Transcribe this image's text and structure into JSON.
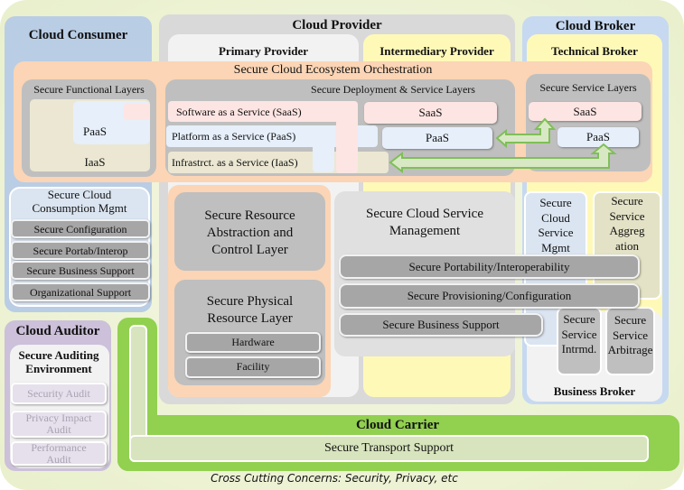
{
  "consumer": {
    "title": "Cloud Consumer",
    "consumption_mgmt": "Secure Cloud Consumption Mgmt",
    "items": [
      "Secure Configuration",
      "Secure Portab/Interop",
      "Secure Business Support",
      "Organizational Support"
    ]
  },
  "provider": {
    "title": "Cloud Provider",
    "primary": "Primary  Provider",
    "intermediary": "Intermediary Provider"
  },
  "broker": {
    "title": "Cloud Broker",
    "technical": "Technical Broker",
    "business": "Business Broker",
    "service_mgmt": "Secure Cloud Service Mgmt",
    "aggregation": "Secure Service Aggreg ation",
    "intermediation": "Secure Service Intrmd.",
    "arbitrage": "Secure Service Arbitrage"
  },
  "orchestration": {
    "title": "Secure Cloud Ecosystem Orchestration",
    "functional": {
      "title": "Secure Functional Layers",
      "paas": "PaaS",
      "iaas": "IaaS"
    },
    "deployment": {
      "title": "Secure Deployment & Service Layers",
      "saas_full": "Software as a Service (SaaS)",
      "paas_full": "Platform as a Service (PaaS)",
      "iaas_full": "Infrastrct. as a Service (IaaS)",
      "saas": "SaaS",
      "paas": "PaaS"
    },
    "service_layers": {
      "title": "Secure Service Layers",
      "saas": "SaaS",
      "paas": "PaaS"
    }
  },
  "resource": {
    "abstraction": "Secure Resource Abstraction and Control Layer",
    "physical": "Secure Physical Resource Layer",
    "hardware": "Hardware",
    "facility": "Facility"
  },
  "service_mgmt": {
    "title": "Secure Cloud Service Management",
    "portability": "Secure Portability/Interoperability",
    "provisioning": "Secure Provisioning/Configuration",
    "business": "Secure Business  Support"
  },
  "auditor": {
    "title": "Cloud Auditor",
    "environment": "Secure Auditing Environment",
    "items": [
      "Security Audit",
      "Privacy Impact Audit",
      "Performance Audit"
    ]
  },
  "carrier": {
    "title": "Cloud Carrier",
    "transport": "Secure Transport Support"
  },
  "footer": "Cross Cutting Concerns: Security, Privacy, etc",
  "colors": {
    "consumer": "#b9cde5",
    "provider": "#d9d9d9",
    "broker": "#c6d9f1",
    "orchestration": "#fbd5b5",
    "intermediary": "#fff9b8",
    "auditor": "#ccc0da",
    "carrier": "#92d050"
  }
}
